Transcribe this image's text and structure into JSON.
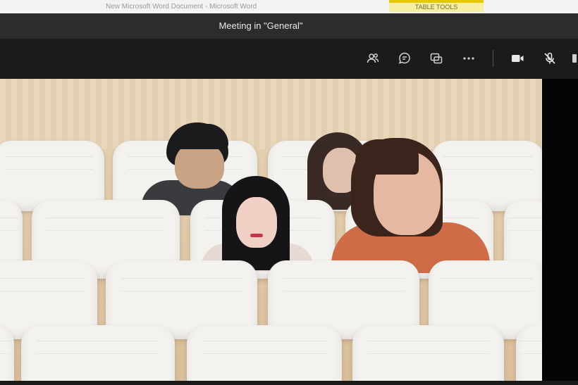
{
  "word_window": {
    "title": "New Microsoft Word Document - Microsoft Word",
    "context_tab": "TABLE TOOLS"
  },
  "meeting": {
    "title": "Meeting in \"General\""
  },
  "toolbar": {
    "buttons": [
      {
        "name": "participants-icon"
      },
      {
        "name": "chat-icon"
      },
      {
        "name": "share-tray-icon"
      },
      {
        "name": "more-actions-icon"
      },
      {
        "name": "camera-icon"
      },
      {
        "name": "mic-icon"
      }
    ]
  },
  "colors": {
    "title_bar": "#2d2c2c",
    "toolbar": "#1b1b1b",
    "word_tab_accent": "#e5c800"
  }
}
